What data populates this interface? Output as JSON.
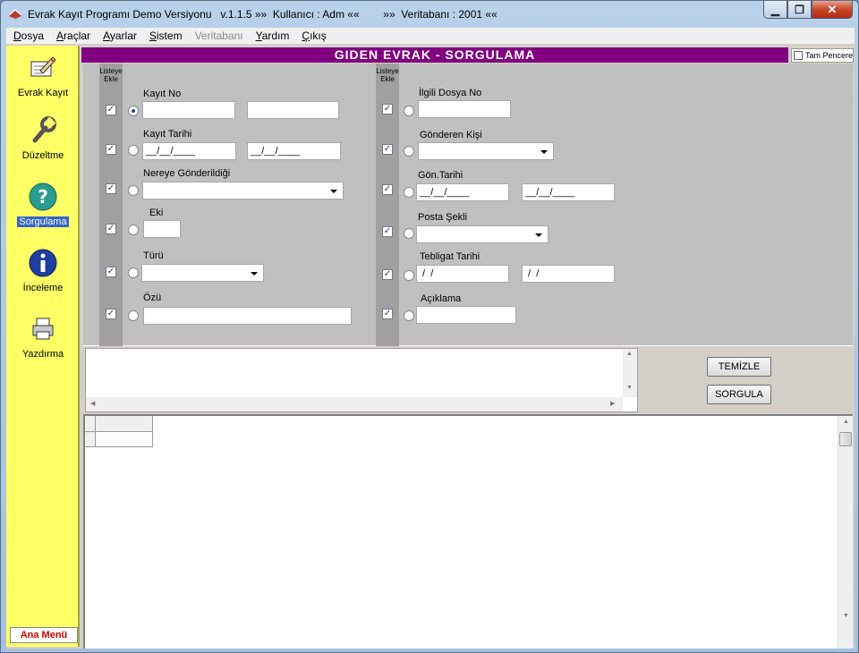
{
  "window": {
    "title": "Evrak Kayıt Programı Demo Versiyonu   v.1.1.5 »»  Kullanıcı : Adm ««        »»  Veritabanı : 2001 ««",
    "min_symbol": "▁",
    "max_symbol": "❐",
    "close_symbol": "✕"
  },
  "menu": [
    {
      "u": "D",
      "rest": "osya",
      "disabled": false
    },
    {
      "u": "A",
      "rest": "raçlar",
      "disabled": false
    },
    {
      "u": "A",
      "rest": "yarlar",
      "disabled": false
    },
    {
      "u": "S",
      "rest": "istem",
      "disabled": false
    },
    {
      "u": "",
      "rest": "Veritabanı",
      "disabled": true
    },
    {
      "u": "Y",
      "rest": "ardım",
      "disabled": false
    },
    {
      "u": "Ç",
      "rest": "ıkış",
      "disabled": false
    }
  ],
  "nav": {
    "items": [
      {
        "label": "Evrak Kayıt",
        "icon": "edit-document-icon",
        "active": false
      },
      {
        "label": "Düzeltme",
        "icon": "wrench-icon",
        "active": false
      },
      {
        "label": "Sorgulama",
        "icon": "question-icon",
        "active": true
      },
      {
        "label": "İnceleme",
        "icon": "info-icon",
        "active": false
      },
      {
        "label": "Yazdırma",
        "icon": "printer-icon",
        "active": false
      }
    ],
    "footer": "Ana Menü"
  },
  "header": {
    "title": "GIDEN EVRAK - SORGULAMA",
    "full_window": "Tam Pencere"
  },
  "liste_header": {
    "line1": "Listeye",
    "line2": "Ekle"
  },
  "left_fields": {
    "kayit_no": "Kayıt No",
    "kayit_tarihi": "Kayıt Tarihi",
    "kayit_tarihi_1": "__/__/____",
    "kayit_tarihi_2": "__/__/____",
    "nereye": "Nereye Gönderildiği",
    "eki": "Eki",
    "turu": "Türü",
    "ozu": "Özü"
  },
  "right_fields": {
    "ilgili_dosya": "İlgili Dosya No",
    "gonderen_kisi": "Gönderen Kişi",
    "gon_tarihi": "Gön.Tarihi",
    "gon_tarihi_1": "__/__/____",
    "gon_tarihi_2": "__/__/____",
    "posta_sekli": "Posta Şekli",
    "tebligat_tarihi": "Tebligat Tarihi",
    "tebligat_1": " /  /",
    "tebligat_2": " /  /",
    "aciklama": "Açıklama"
  },
  "buttons": {
    "temizle": "TEMİZLE",
    "sorgula": "SORGULA"
  },
  "colors": {
    "header": "#800080",
    "nav": "#ffff66",
    "ana_menu_text": "#d00000",
    "active_nav": "#3366cc"
  }
}
